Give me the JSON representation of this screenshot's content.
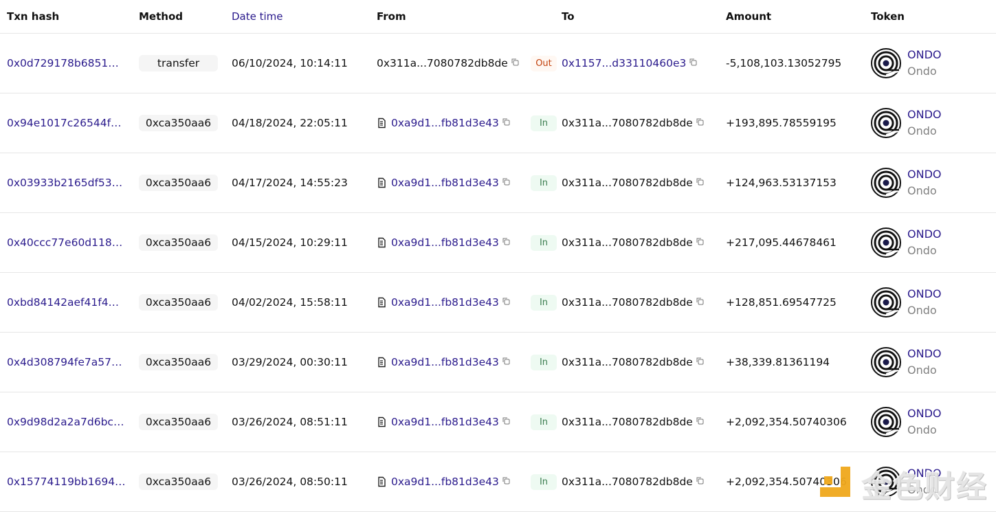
{
  "columns": {
    "txn_hash": "Txn hash",
    "method": "Method",
    "date_time": "Date time",
    "from": "From",
    "to": "To",
    "amount": "Amount",
    "token": "Token"
  },
  "colors": {
    "link": "#2a1a8c",
    "out": "#c2410c",
    "in": "#3a7d4f",
    "watermark_accent": "#f0a81c"
  },
  "rows": [
    {
      "hash": "0x0d729178b6851…",
      "method": "transfer",
      "date": "06/10/2024, 10:14:11",
      "from": "0x311a...7080782db8de",
      "from_contract": false,
      "direction": "Out",
      "to": "0x1157...d33110460e3",
      "to_link": true,
      "amount": "-5,108,103.13052795",
      "token_symbol": "ONDO",
      "token_name": "Ondo"
    },
    {
      "hash": "0x94e1017c26544f…",
      "method": "0xca350aa6",
      "date": "04/18/2024, 22:05:11",
      "from": "0xa9d1...fb81d3e43",
      "from_contract": true,
      "direction": "In",
      "to": "0x311a...7080782db8de",
      "to_link": false,
      "amount": "+193,895.78559195",
      "token_symbol": "ONDO",
      "token_name": "Ondo"
    },
    {
      "hash": "0x03933b2165df53…",
      "method": "0xca350aa6",
      "date": "04/17/2024, 14:55:23",
      "from": "0xa9d1...fb81d3e43",
      "from_contract": true,
      "direction": "In",
      "to": "0x311a...7080782db8de",
      "to_link": false,
      "amount": "+124,963.53137153",
      "token_symbol": "ONDO",
      "token_name": "Ondo"
    },
    {
      "hash": "0x40ccc77e60d118…",
      "method": "0xca350aa6",
      "date": "04/15/2024, 10:29:11",
      "from": "0xa9d1...fb81d3e43",
      "from_contract": true,
      "direction": "In",
      "to": "0x311a...7080782db8de",
      "to_link": false,
      "amount": "+217,095.44678461",
      "token_symbol": "ONDO",
      "token_name": "Ondo"
    },
    {
      "hash": "0xbd84142aef41f4…",
      "method": "0xca350aa6",
      "date": "04/02/2024, 15:58:11",
      "from": "0xa9d1...fb81d3e43",
      "from_contract": true,
      "direction": "In",
      "to": "0x311a...7080782db8de",
      "to_link": false,
      "amount": "+128,851.69547725",
      "token_symbol": "ONDO",
      "token_name": "Ondo"
    },
    {
      "hash": "0x4d308794fe7a57…",
      "method": "0xca350aa6",
      "date": "03/29/2024, 00:30:11",
      "from": "0xa9d1...fb81d3e43",
      "from_contract": true,
      "direction": "In",
      "to": "0x311a...7080782db8de",
      "to_link": false,
      "amount": "+38,339.81361194",
      "token_symbol": "ONDO",
      "token_name": "Ondo"
    },
    {
      "hash": "0x9d98d2a2a7d6bc…",
      "method": "0xca350aa6",
      "date": "03/26/2024, 08:51:11",
      "from": "0xa9d1...fb81d3e43",
      "from_contract": true,
      "direction": "In",
      "to": "0x311a...7080782db8de",
      "to_link": false,
      "amount": "+2,092,354.50740306",
      "token_symbol": "ONDO",
      "token_name": "Ondo"
    },
    {
      "hash": "0x15774119bb1694…",
      "method": "0xca350aa6",
      "date": "03/26/2024, 08:50:11",
      "from": "0xa9d1...fb81d3e43",
      "from_contract": true,
      "direction": "In",
      "to": "0x311a...7080782db8de",
      "to_link": false,
      "amount": "+2,092,354.50740306",
      "token_symbol": "ONDO",
      "token_name": "Ondo"
    }
  ],
  "watermark": {
    "text": "金色财经"
  }
}
